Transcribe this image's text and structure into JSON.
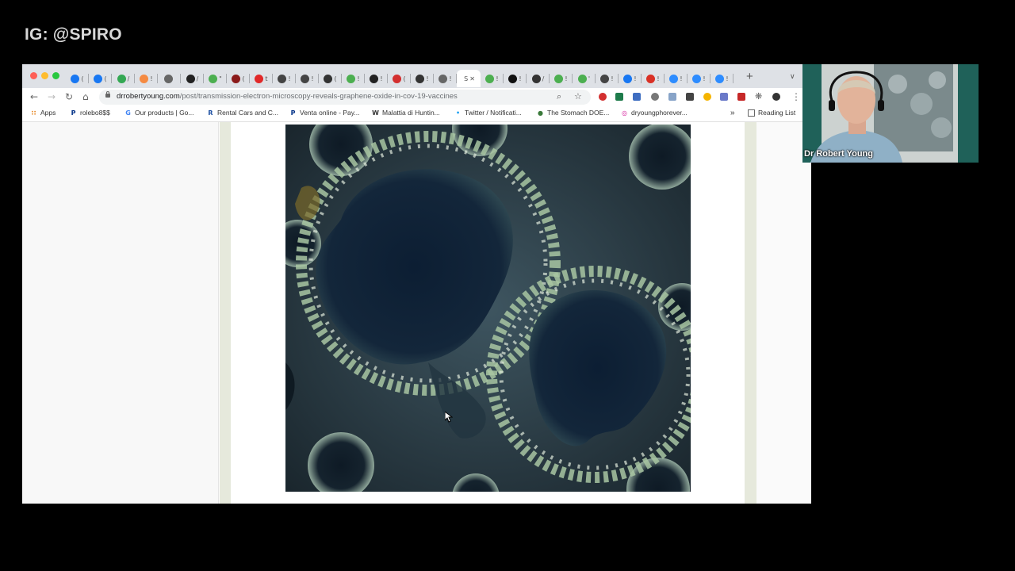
{
  "watermark": "IG: @SPIRO",
  "browser": {
    "url_host": "drrobertyoung.com",
    "url_path": "/post/transmission-electron-microscopy-reveals-graphene-oxide-in-cov-19-vaccines",
    "tabs": [
      {
        "icon": "facebook-icon",
        "letter": "(",
        "color": "#1877f2"
      },
      {
        "icon": "facebook-icon",
        "letter": "(",
        "color": "#1877f2"
      },
      {
        "icon": "chat-icon",
        "letter": "/",
        "color": "#34a853"
      },
      {
        "icon": "circle-orange-icon",
        "letter": "!",
        "color": "#f58a42"
      },
      {
        "icon": "wix-icon",
        "letter": "",
        "color": "#666"
      },
      {
        "icon": "amazon-icon",
        "letter": "/",
        "color": "#222"
      },
      {
        "icon": "green-leaf-icon",
        "letter": "\"",
        "color": "#4caf50"
      },
      {
        "icon": "red-dot-icon",
        "letter": "(",
        "color": "#8b1a1a"
      },
      {
        "icon": "flipboard-icon",
        "letter": "t",
        "color": "#e12828"
      },
      {
        "icon": "stack-icon",
        "letter": "!",
        "color": "#444"
      },
      {
        "icon": "stack-icon",
        "letter": "!",
        "color": "#444"
      },
      {
        "icon": "play-icon",
        "letter": "(",
        "color": "#333"
      },
      {
        "icon": "green-leaf-icon",
        "letter": "!",
        "color": "#4caf50"
      },
      {
        "icon": "font-a-icon",
        "letter": "!",
        "color": "#222"
      },
      {
        "icon": "refresh-red-icon",
        "letter": "(",
        "color": "#d32f2f"
      },
      {
        "icon": "globe-icon",
        "letter": "!",
        "color": "#333"
      },
      {
        "icon": "wix-icon",
        "letter": "!",
        "color": "#666"
      },
      {
        "icon": "active-tab",
        "letter": "S",
        "color": "#444"
      },
      {
        "icon": "green-leaf-icon",
        "letter": "!",
        "color": "#4caf50"
      },
      {
        "icon": "terminal-icon",
        "letter": "!",
        "color": "#111"
      },
      {
        "icon": "globe-icon",
        "letter": "/",
        "color": "#333"
      },
      {
        "icon": "green-leaf-icon",
        "letter": "!",
        "color": "#4caf50"
      },
      {
        "icon": "green-leaf-icon",
        "letter": "'",
        "color": "#4caf50"
      },
      {
        "icon": "signature-icon",
        "letter": "!",
        "color": "#444"
      },
      {
        "icon": "facebook-icon",
        "letter": "!",
        "color": "#1877f2"
      },
      {
        "icon": "gmail-icon",
        "letter": "!",
        "color": "#d93025"
      },
      {
        "icon": "zoom-icon",
        "letter": "!",
        "color": "#2d8cff"
      },
      {
        "icon": "zoom-icon",
        "letter": "!",
        "color": "#2d8cff"
      },
      {
        "icon": "zoom-icon",
        "letter": "!",
        "color": "#2d8cff"
      }
    ],
    "bookmarks": [
      {
        "label": "Apps",
        "icon": "apps-grid-icon",
        "color": "#e37400"
      },
      {
        "label": "rolebo8$$",
        "icon": "paypal-icon",
        "color": "#003087"
      },
      {
        "label": "Our products | Go...",
        "icon": "google-icon",
        "color": "#4285f4"
      },
      {
        "label": "Rental Cars and C...",
        "icon": "rental-icon",
        "color": "#1a4da1"
      },
      {
        "label": "Venta online - Pay...",
        "icon": "paypal-icon",
        "color": "#003087"
      },
      {
        "label": "Malattia di Huntin...",
        "icon": "wikipedia-icon",
        "color": "#333"
      },
      {
        "label": "Twitter / Notificati...",
        "icon": "twitter-icon",
        "color": "#1da1f2"
      },
      {
        "label": "The Stomach DOE...",
        "icon": "globe-icon",
        "color": "#3b7a3b"
      },
      {
        "label": "dryoungphorever...",
        "icon": "instagram-icon",
        "color": "#d6249f"
      }
    ],
    "bookmarks_more": "»",
    "reading_list": "Reading List"
  },
  "webcam": {
    "name": "Dr Robert Young"
  }
}
